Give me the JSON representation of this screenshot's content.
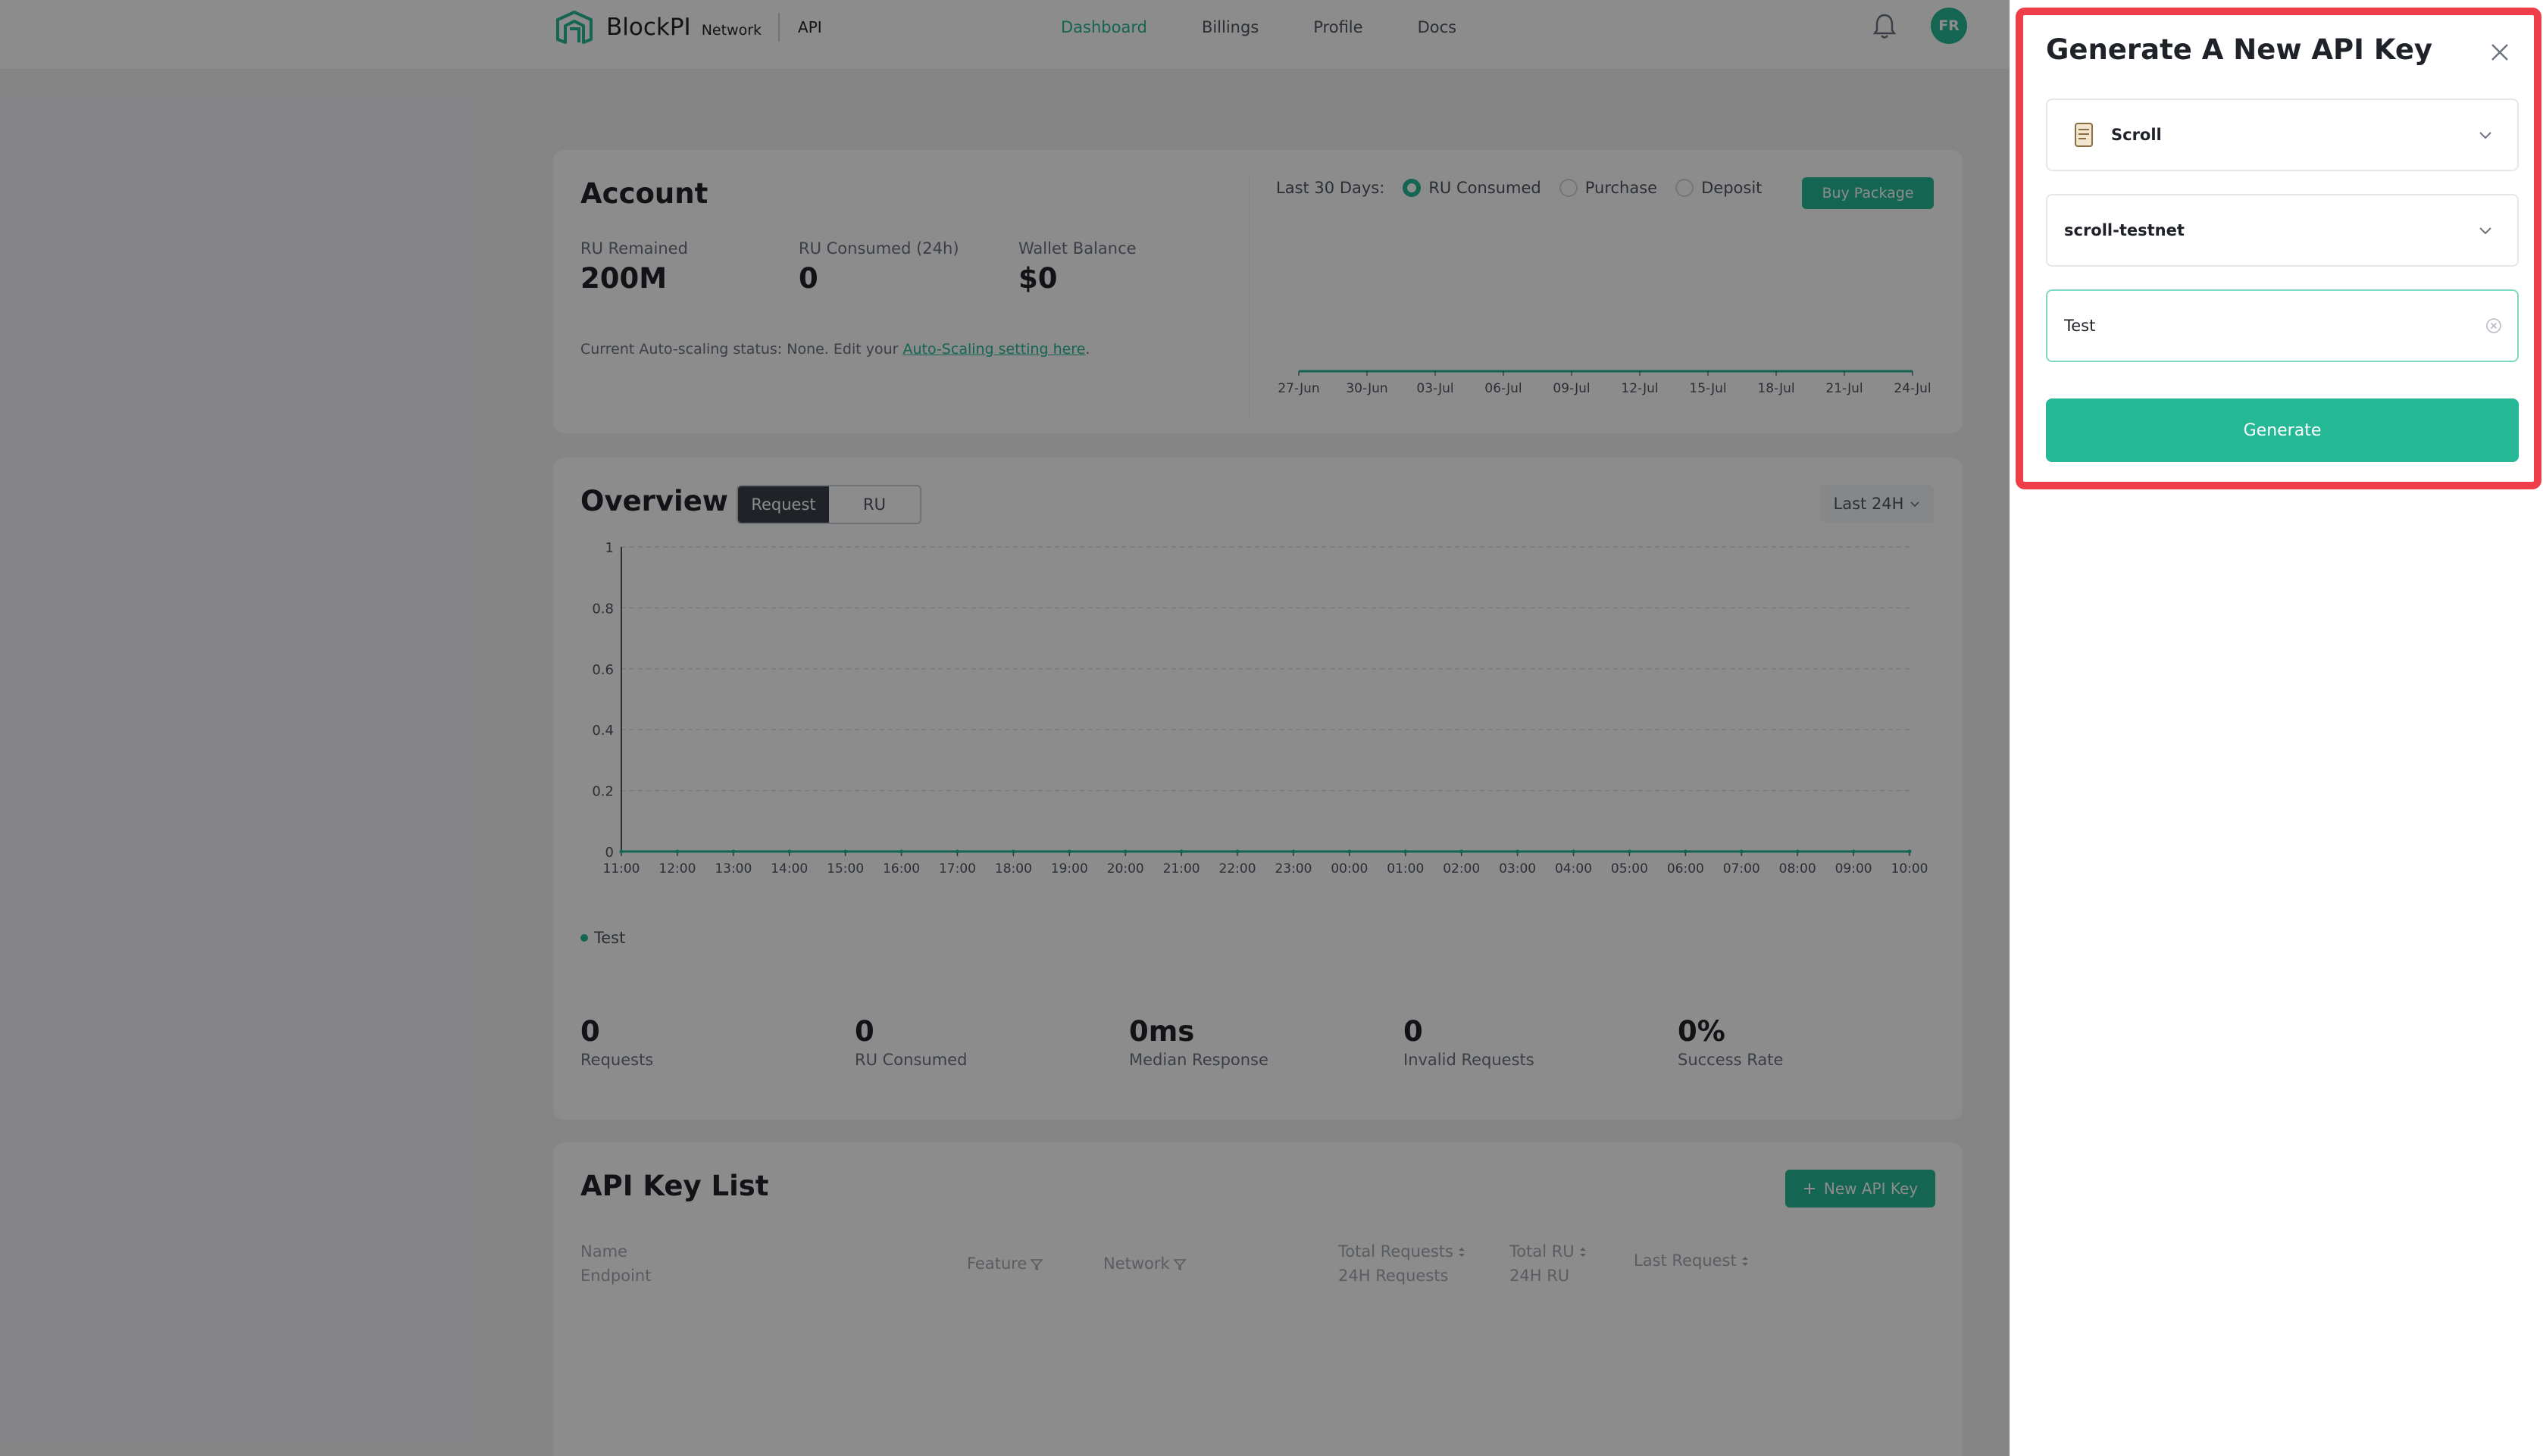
{
  "nav": {
    "brand": "BlockPI",
    "brand_sub": "Network",
    "section": "API",
    "links": [
      {
        "label": "Dashboard",
        "active": true
      },
      {
        "label": "Billings",
        "active": false
      },
      {
        "label": "Profile",
        "active": false
      },
      {
        "label": "Docs",
        "active": false
      }
    ],
    "avatar_initials": "FR"
  },
  "account": {
    "title": "Account",
    "stats": [
      {
        "label": "RU Remained",
        "value": "200M"
      },
      {
        "label": "RU Consumed (24h)",
        "value": "0"
      },
      {
        "label": "Wallet Balance",
        "value": "$0"
      }
    ],
    "autoscale_text": "Current Auto-scaling status: None. Edit your ",
    "autoscale_link": "Auto-Scaling setting here",
    "autoscale_end": ".",
    "period_label": "Last 30 Days:",
    "radios": [
      {
        "label": "RU Consumed",
        "checked": true
      },
      {
        "label": "Purchase",
        "checked": false
      },
      {
        "label": "Deposit",
        "checked": false
      }
    ],
    "buy_label": "Buy Package"
  },
  "mini_chart_data": {
    "type": "line",
    "x": [
      "27-Jun",
      "30-Jun",
      "03-Jul",
      "06-Jul",
      "09-Jul",
      "12-Jul",
      "15-Jul",
      "18-Jul",
      "21-Jul",
      "24-Jul"
    ],
    "values": [
      0,
      0,
      0,
      0,
      0,
      0,
      0,
      0,
      0,
      0
    ],
    "color": "#25b894"
  },
  "overview": {
    "title": "Overview",
    "toggles": [
      {
        "label": "Request",
        "active": true
      },
      {
        "label": "RU",
        "active": false
      }
    ],
    "range_label": "Last 24H",
    "legend_label": "Test",
    "metrics": [
      {
        "value": "0",
        "label": "Requests"
      },
      {
        "value": "0",
        "label": "RU Consumed"
      },
      {
        "value": "0ms",
        "label": "Median Response"
      },
      {
        "value": "0",
        "label": "Invalid Requests"
      },
      {
        "value": "0%",
        "label": "Success Rate"
      }
    ]
  },
  "chart_data": {
    "type": "line",
    "x": [
      "11:00",
      "12:00",
      "13:00",
      "14:00",
      "15:00",
      "16:00",
      "17:00",
      "18:00",
      "19:00",
      "20:00",
      "21:00",
      "22:00",
      "23:00",
      "00:00",
      "01:00",
      "02:00",
      "03:00",
      "04:00",
      "05:00",
      "06:00",
      "07:00",
      "08:00",
      "09:00",
      "10:00"
    ],
    "y_ticks": [
      "0",
      "0.2",
      "0.4",
      "0.6",
      "0.8",
      "1"
    ],
    "ylim": [
      0,
      1
    ],
    "series": [
      {
        "name": "Test",
        "values": [
          0,
          0,
          0,
          0,
          0,
          0,
          0,
          0,
          0,
          0,
          0,
          0,
          0,
          0,
          0,
          0,
          0,
          0,
          0,
          0,
          0,
          0,
          0,
          0
        ],
        "color": "#25b894"
      }
    ],
    "grid": true
  },
  "api_keys": {
    "title": "API Key List",
    "new_key_label": "New API Key",
    "columns": [
      {
        "line1": "Name",
        "line2": "Endpoint"
      },
      {
        "line1": "Feature",
        "line2": ""
      },
      {
        "line1": "Network",
        "line2": ""
      },
      {
        "line1": "Total Requests",
        "line2": "24H Requests"
      },
      {
        "line1": "Total RU",
        "line2": "24H RU"
      },
      {
        "line1": "Last Request",
        "line2": ""
      }
    ]
  },
  "drawer": {
    "title": "Generate A New API Key",
    "chain_value": "Scroll",
    "network_value": "scroll-testnet",
    "name_value": "Test",
    "generate_label": "Generate"
  },
  "colors": {
    "accent": "#25b894",
    "highlight": "#ef3e4a"
  }
}
